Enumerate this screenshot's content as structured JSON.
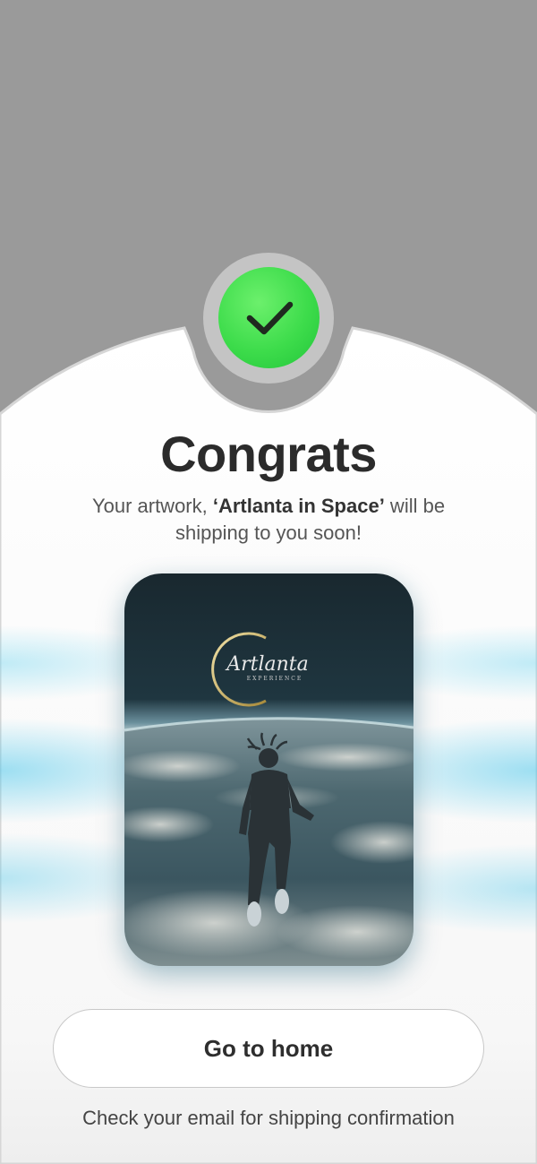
{
  "title": "Congrats",
  "message": {
    "prefix": "Your artwork, ",
    "artwork_name": "‘Artlanta in Space’",
    "suffix": " will be shipping to you soon!"
  },
  "artwork_image": {
    "logo_script": "Artlanta",
    "logo_caption": "EXPERIENCE"
  },
  "home_button_label": "Go to home",
  "footnote": "Check your email for shipping confirmation",
  "colors": {
    "success": "#3ddc4b",
    "backdrop": "#9a9a9a",
    "sheet": "#ffffff",
    "glow": "#50c8eb"
  },
  "icons": [
    "check-icon"
  ]
}
